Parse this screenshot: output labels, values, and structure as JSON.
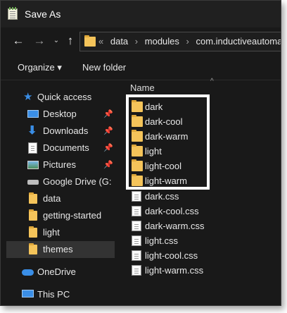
{
  "window": {
    "title": "Save As"
  },
  "nav": {
    "back_icon": "←",
    "forward_icon": "→",
    "recent_icon": "⌄",
    "up_icon": "↑",
    "breadcrumbs": [
      "«",
      "data",
      "›",
      "modules",
      "›",
      "com.inductiveautomation"
    ]
  },
  "toolbar": {
    "organize_label": "Organize ▾",
    "new_folder_label": "New folder"
  },
  "sidebar": {
    "items": [
      {
        "label": "Quick access",
        "icon": "star-icon"
      },
      {
        "label": "Desktop",
        "icon": "desktop-icon",
        "pinned": true
      },
      {
        "label": "Downloads",
        "icon": "download-icon",
        "pinned": true
      },
      {
        "label": "Documents",
        "icon": "documents-icon",
        "pinned": true
      },
      {
        "label": "Pictures",
        "icon": "pictures-icon",
        "pinned": true
      },
      {
        "label": "Google Drive (G:",
        "icon": "drive-icon",
        "pinned": false
      },
      {
        "label": "data",
        "icon": "folder-icon"
      },
      {
        "label": "getting-started",
        "icon": "folder-icon"
      },
      {
        "label": "light",
        "icon": "folder-icon"
      },
      {
        "label": "themes",
        "icon": "folder-icon",
        "selected": true
      },
      {
        "label": "OneDrive",
        "icon": "cloud-icon"
      },
      {
        "label": "This PC",
        "icon": "computer-icon"
      }
    ]
  },
  "file_list": {
    "column_header": "Name",
    "sort_icon": "^",
    "folders": [
      "dark",
      "dark-cool",
      "dark-warm",
      "light",
      "light-cool",
      "light-warm"
    ],
    "files": [
      "dark.css",
      "dark-cool.css",
      "dark-warm.css",
      "light.css",
      "light-cool.css",
      "light-warm.css"
    ]
  },
  "colors": {
    "folder": "#f5c45a",
    "accent_blue": "#3a8ee6",
    "background": "#191919"
  }
}
